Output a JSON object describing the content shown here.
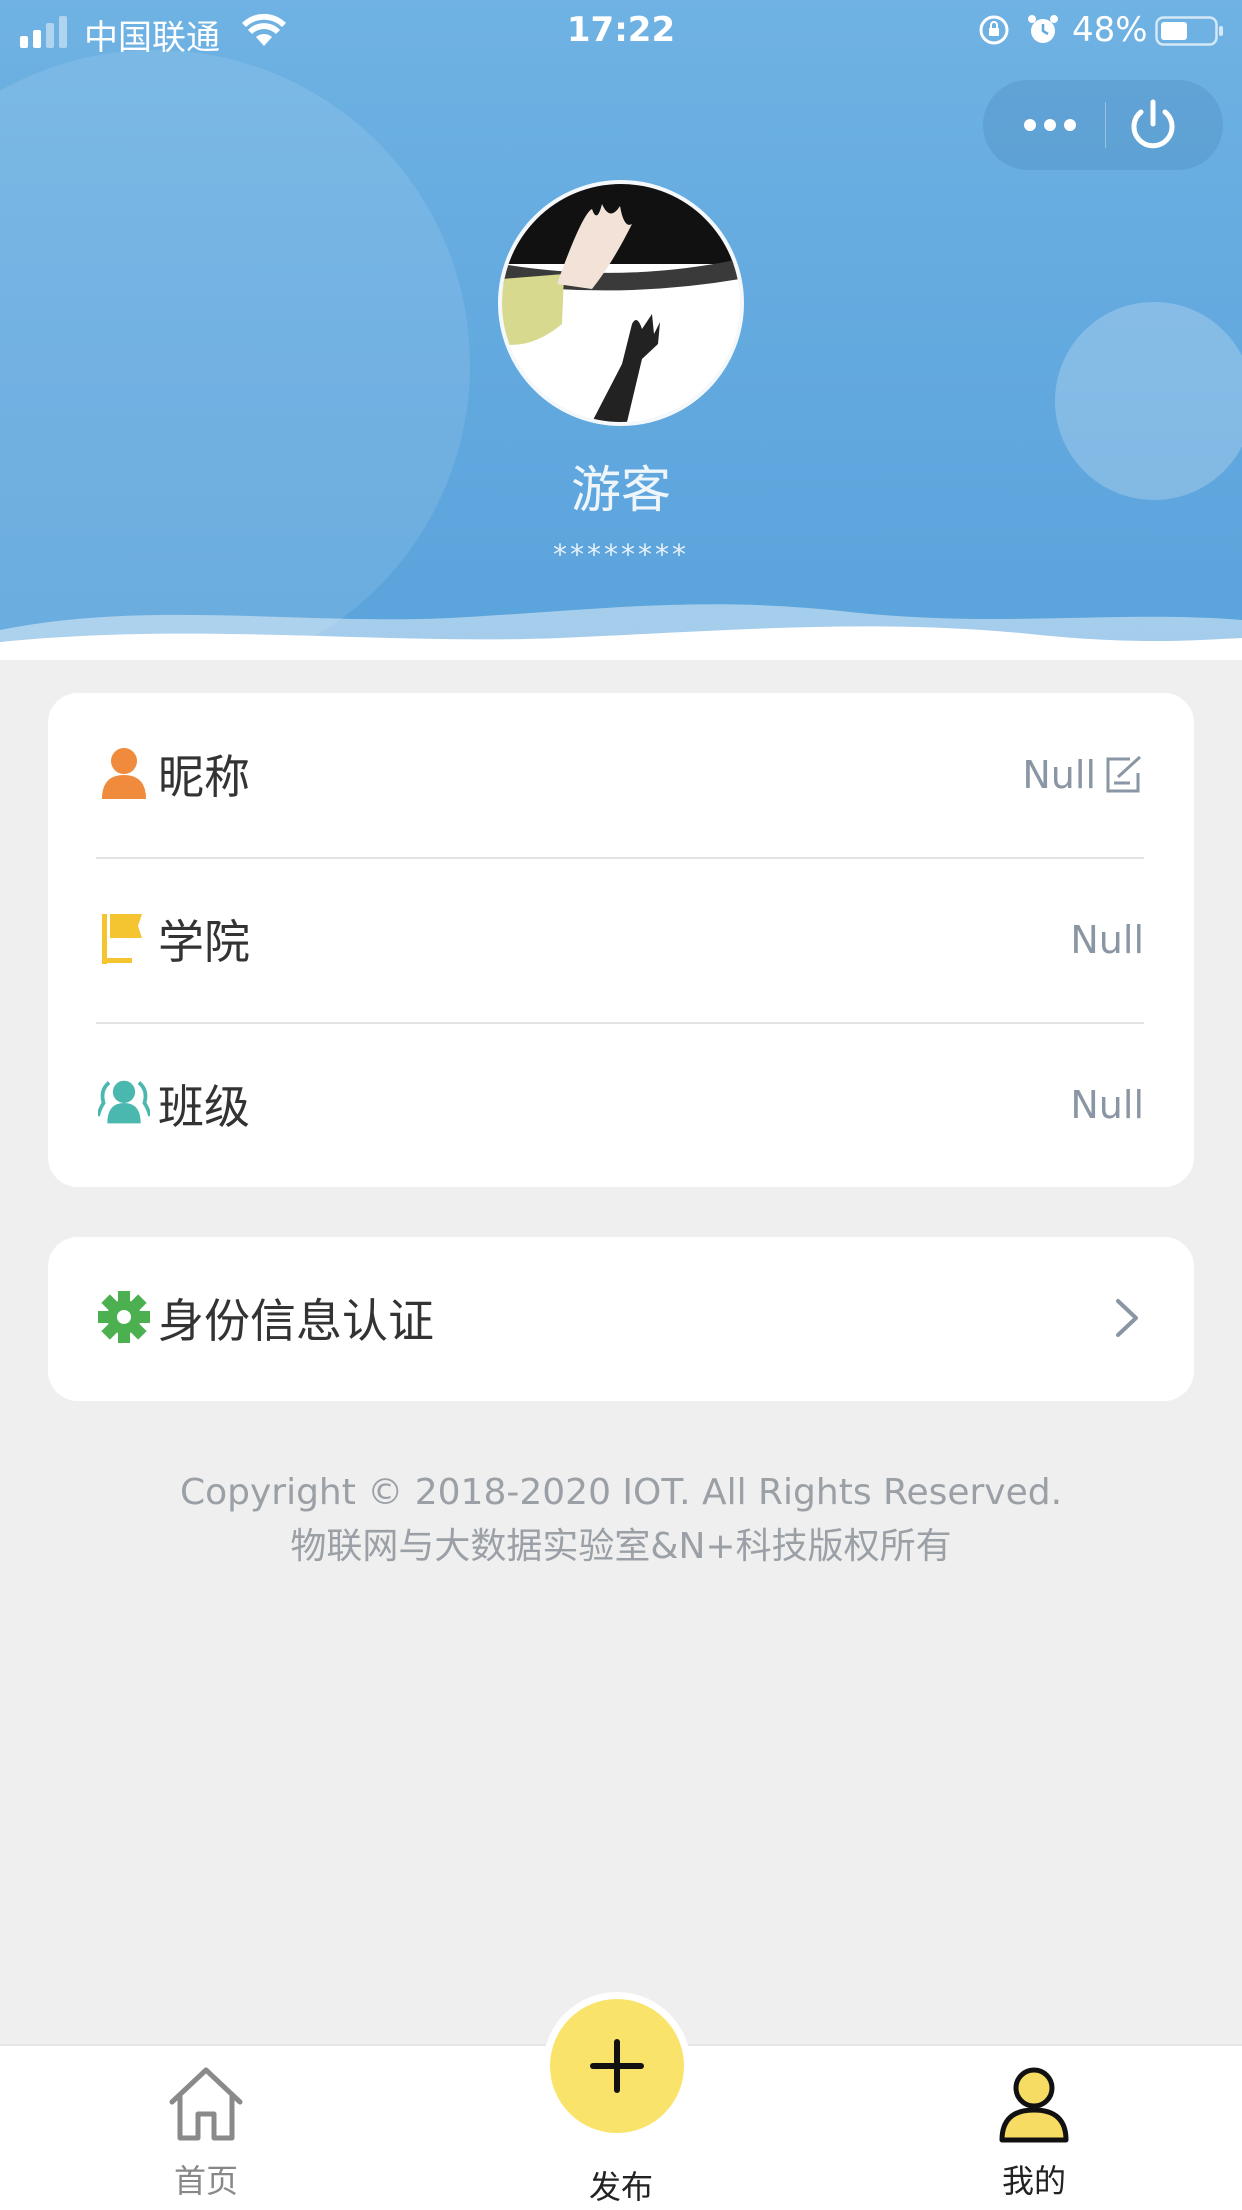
{
  "status_bar": {
    "carrier": "中国联通",
    "time": "17:22",
    "battery": "48%"
  },
  "icons": {
    "signal": "signal-bars-icon",
    "wifi": "wifi-icon",
    "orientation_lock": "orientation-lock-icon",
    "alarm": "alarm-icon",
    "battery": "battery-icon",
    "more": "more-dots-icon",
    "power": "power-icon",
    "nickname": "person-icon",
    "college": "flag-icon",
    "class": "group-icon",
    "verify": "gear-icon",
    "edit": "edit-icon",
    "chevron": "chevron-right-icon",
    "home": "home-icon",
    "publish": "plus-icon",
    "mine": "user-icon"
  },
  "profile": {
    "name": "游客",
    "id_mask": "********"
  },
  "info": [
    {
      "label": "昵称",
      "value": "Null"
    },
    {
      "label": "学院",
      "value": "Null"
    },
    {
      "label": "班级",
      "value": "Null"
    }
  ],
  "verify": {
    "label": "身份信息认证"
  },
  "footer": {
    "line1": "Copyright © 2018-2020 IOT. All Rights Reserved.",
    "line2": "物联网与大数据实验室&N+科技版权所有"
  },
  "tabbar": {
    "home": "首页",
    "publish": "发布",
    "mine": "我的",
    "active": "mine"
  },
  "colors": {
    "header_blue": "#62a9df",
    "nickname_icon": "#f08a3c",
    "college_icon": "#f5c531",
    "class_icon": "#4bb8b0",
    "verify_icon": "#4caf50",
    "fab": "#fae36a"
  }
}
